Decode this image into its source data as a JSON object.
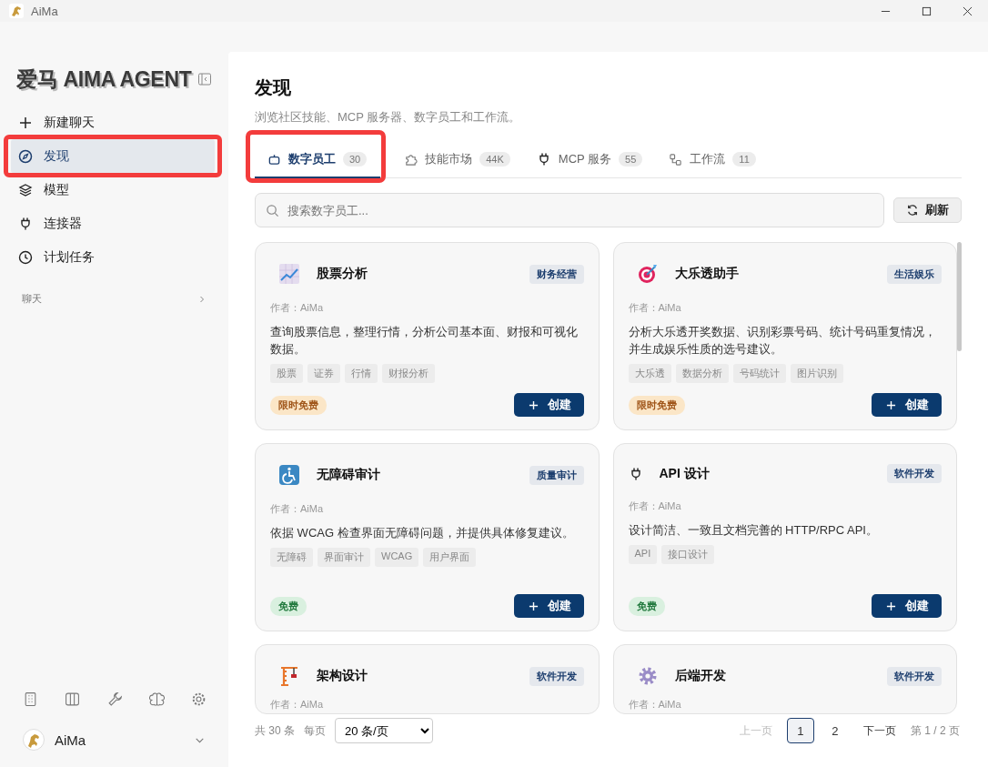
{
  "window": {
    "title": "AiMa"
  },
  "sidebar": {
    "logo": "爱马 AIMA AGENT",
    "nav": [
      {
        "label": "新建聊天",
        "selected": false,
        "highlighted": false
      },
      {
        "label": "发现",
        "selected": true,
        "highlighted": true
      },
      {
        "label": "模型",
        "selected": false,
        "highlighted": false
      },
      {
        "label": "连接器",
        "selected": false,
        "highlighted": false
      },
      {
        "label": "计划任务",
        "selected": false,
        "highlighted": false
      }
    ],
    "section": "聊天",
    "user": "AiMa"
  },
  "page": {
    "title": "发现",
    "subtitle": "浏览社区技能、MCP 服务器、数字员工和工作流。",
    "tabs": [
      {
        "label": "数字员工",
        "count": "30",
        "selected": true,
        "highlighted": true
      },
      {
        "label": "技能市场",
        "count": "44K",
        "selected": false,
        "highlighted": false
      },
      {
        "label": "MCP 服务",
        "count": "55",
        "selected": false,
        "highlighted": false
      },
      {
        "label": "工作流",
        "count": "11",
        "selected": false,
        "highlighted": false
      }
    ],
    "search": {
      "placeholder": "搜索数字员工..."
    },
    "refresh": "刷新",
    "cards": [
      {
        "title": "股票分析",
        "category": "财务经营",
        "author": "作者：AiMa",
        "description": "查询股票信息，整理行情，分析公司基本面、财报和可视化数据。",
        "tags": [
          "股票",
          "证券",
          "行情",
          "财报分析"
        ],
        "price": {
          "text": "限时免费",
          "kind": "limited"
        },
        "action": "创建"
      },
      {
        "title": "大乐透助手",
        "category": "生活娱乐",
        "author": "作者：AiMa",
        "description": "分析大乐透开奖数据、识别彩票号码、统计号码重复情况，并生成娱乐性质的选号建议。",
        "tags": [
          "大乐透",
          "数据分析",
          "号码统计",
          "图片识别"
        ],
        "price": {
          "text": "限时免费",
          "kind": "limited"
        },
        "action": "创建"
      },
      {
        "title": "无障碍审计",
        "category": "质量审计",
        "author": "作者：AiMa",
        "description": "依据 WCAG 检查界面无障碍问题，并提供具体修复建议。",
        "tags": [
          "无障碍",
          "界面审计",
          "WCAG",
          "用户界面"
        ],
        "price": {
          "text": "免费",
          "kind": "free"
        },
        "action": "创建"
      },
      {
        "title": "API 设计",
        "category": "软件开发",
        "author": "作者：AiMa",
        "description": "设计简洁、一致且文档完善的 HTTP/RPC API。",
        "tags": [
          "API",
          "接口设计"
        ],
        "price": {
          "text": "免费",
          "kind": "free"
        },
        "action": "创建"
      },
      {
        "title": "架构设计",
        "category": "软件开发",
        "author": "作者：AiMa"
      },
      {
        "title": "后端开发",
        "category": "软件开发",
        "author": "作者：AiMa"
      }
    ],
    "pagination": {
      "total": "共 30 条",
      "per_page_label": "每页",
      "per_page": "20 条/页",
      "prev": {
        "label": "上一页",
        "disabled": true
      },
      "pages": [
        {
          "label": "1",
          "selected": true
        },
        {
          "label": "2",
          "selected": false
        }
      ],
      "next": {
        "label": "下一页",
        "disabled": false
      },
      "summary": "第 1 / 2 页"
    }
  }
}
